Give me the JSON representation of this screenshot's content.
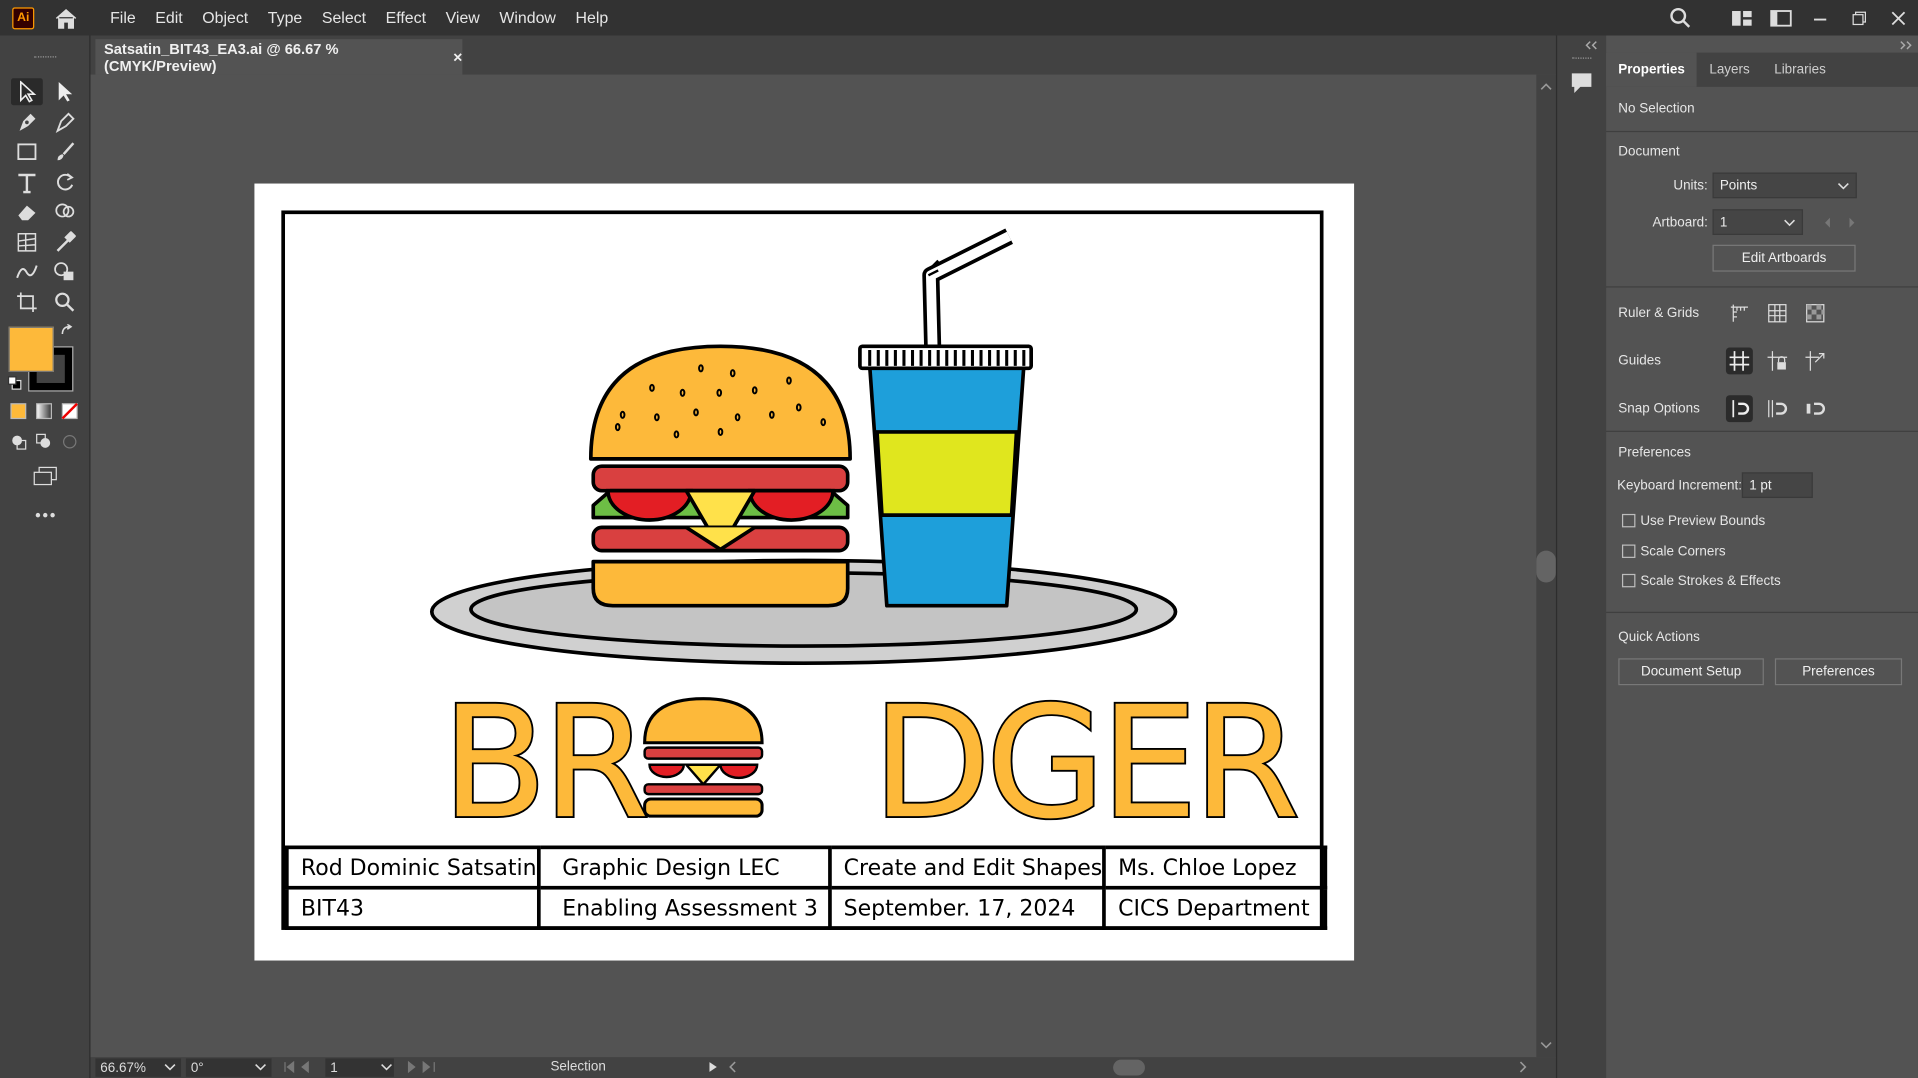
{
  "app": {
    "logo": "Ai"
  },
  "menu": [
    "File",
    "Edit",
    "Object",
    "Type",
    "Select",
    "Effect",
    "View",
    "Window",
    "Help"
  ],
  "document": {
    "tab_title": "Satsatin_BIT43_EA3.ai @ 66.67 % (CMYK/Preview)",
    "close": "×"
  },
  "artwork": {
    "logo_text_left": "BR",
    "logo_text_right": "DGER",
    "info_table": [
      [
        "Rod Dominic Satsatin",
        "Graphic Design LEC",
        "Create and Edit Shapes",
        "Ms. Chloe Lopez"
      ],
      [
        "BIT43",
        "Enabling Assessment 3",
        "September. 17, 2024",
        "CICS Department"
      ]
    ],
    "colors": {
      "bun": "#FDB93A",
      "tomato": "#E31E24",
      "lettuce": "#6DBE45",
      "patty": "#D94040",
      "cheese": "#FFE14A",
      "cup_blue": "#1E9FDA",
      "cup_band": "#E0E61E",
      "plate": "#D0D0D0"
    }
  },
  "status": {
    "zoom": "66.67%",
    "rotation": "0°",
    "artboard": "1",
    "tool": "Selection"
  },
  "panel": {
    "tabs": [
      "Properties",
      "Layers",
      "Libraries"
    ],
    "selection": "No Selection",
    "document_heading": "Document",
    "units_label": "Units:",
    "units_value": "Points",
    "artboard_label": "Artboard:",
    "artboard_value": "1",
    "edit_artboards": "Edit Artboards",
    "ruler_grids": "Ruler & Grids",
    "guides": "Guides",
    "snap_options": "Snap Options",
    "preferences_heading": "Preferences",
    "keyboard_increment_label": "Keyboard Increment:",
    "keyboard_increment_value": "1 pt",
    "checkboxes": [
      "Use Preview Bounds",
      "Scale Corners",
      "Scale Strokes & Effects"
    ],
    "quick_actions": "Quick Actions",
    "document_setup": "Document Setup",
    "preferences_button": "Preferences"
  },
  "accent": {
    "fill_color": "#FDB93A"
  }
}
